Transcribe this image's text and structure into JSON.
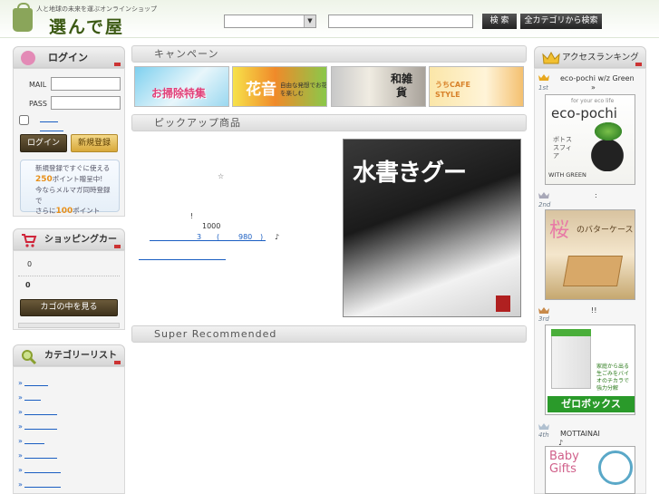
{
  "header": {
    "tagline": "人と地球の未来を運ぶオンラインショップ",
    "logo": "選んで屋",
    "search_placeholder": "",
    "search_button": "検 索",
    "all_search_button": "全カテゴリから検索"
  },
  "login": {
    "title": "ログイン",
    "mail_label": "MAIL",
    "pass_label": "PASS",
    "login_button": "ログイン",
    "register_button": "新規登録",
    "promo": {
      "line1": "新規登録ですぐに使える",
      "points1": "250",
      "line2": "ポイント贈呈中!",
      "line3": "今ならメルマガ同時登録で",
      "line4_prefix": "さらに",
      "points2": "100",
      "line4_suffix": "ポイント"
    }
  },
  "cart": {
    "title": "ショッピングカート",
    "count": "0",
    "total": "0",
    "view_button": "カゴの中を見る"
  },
  "categories": {
    "title": "カテゴリーリスト",
    "bullet": "»"
  },
  "campaign": {
    "title": "キャンペーン",
    "banners": [
      {
        "text": "お掃除特集"
      },
      {
        "text": "花音",
        "sub": "自由な発想でお花を楽しむ"
      },
      {
        "text": "和雑貨"
      },
      {
        "text": "うちCAFE STYLE"
      }
    ]
  },
  "pickup": {
    "title": "ピックアップ商品",
    "star": "☆",
    "exclaim": "!",
    "price_num": "1000",
    "line3_a": "3",
    "line3_b": "(",
    "line3_c": "980",
    "line3_d": ")",
    "line3_e": "♪",
    "product_image_text": "水書きグー"
  },
  "super": {
    "title": "Super Recommended"
  },
  "ranking": {
    "title": "アクセスランキング",
    "items": [
      {
        "rank": "1st",
        "name": "eco-pochi w/z Green",
        "after": "»",
        "img_caption": "for your eco life",
        "img_title": "eco-pochi",
        "img_sub": "ボトス スフィア",
        "img_foot": "WITH GREEN"
      },
      {
        "rank": "2nd",
        "name": ":",
        "img_title": "桜",
        "img_sub": "のバターケース"
      },
      {
        "rank": "3rd",
        "name": "!!",
        "img_title": "ゼロボックス",
        "img_sub": "家庭から出る生ごみをバイオのチカラで強力分解"
      },
      {
        "rank": "4th",
        "name": "MOTTAINAI",
        "after": "♪",
        "img_title": "Baby Gifts"
      }
    ]
  },
  "colors": {
    "accent_green": "#3c5a14",
    "link_blue": "#1a5ec2",
    "dark_button": "#3e321c",
    "gold_button": "#d8a83a"
  }
}
